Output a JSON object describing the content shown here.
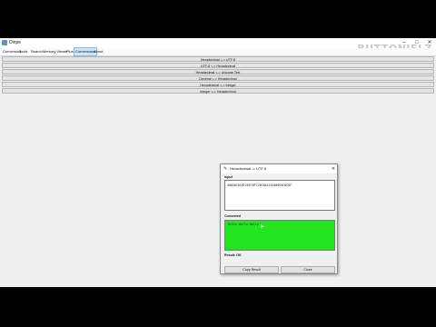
{
  "window": {
    "title": "Dinpe",
    "watermark": "BUTTONIELZ"
  },
  "menus": [
    "Conversion",
    "Tools",
    "Search",
    "Memory Viewer",
    "Plus",
    "Conversions",
    "About"
  ],
  "active_menu_index": 5,
  "conversions": [
    {
      "label": "Hexadecimal <-> UTF-8"
    },
    {
      "label": "UTF-8 <-> Hexadecimal"
    },
    {
      "label": "Hexadecimal <-> Unicode Text"
    },
    {
      "label": "Decimal <-> Hexadecimal"
    },
    {
      "label": "Hexadecimal <-> Integer"
    },
    {
      "label": "Integer <-> Hexadecimal"
    }
  ],
  "dialog": {
    "title": "Hexadecimal -> UTF-8",
    "input_label": "Input",
    "input_value": "48656C6C6F20576F726C64212048656C6C6F",
    "output_label": "Converted",
    "output_value": "Hello World Hello",
    "result_text": "Result: OK",
    "copy_button": "Copy Result",
    "close_button": "Close",
    "output_color": "#22e41f"
  }
}
